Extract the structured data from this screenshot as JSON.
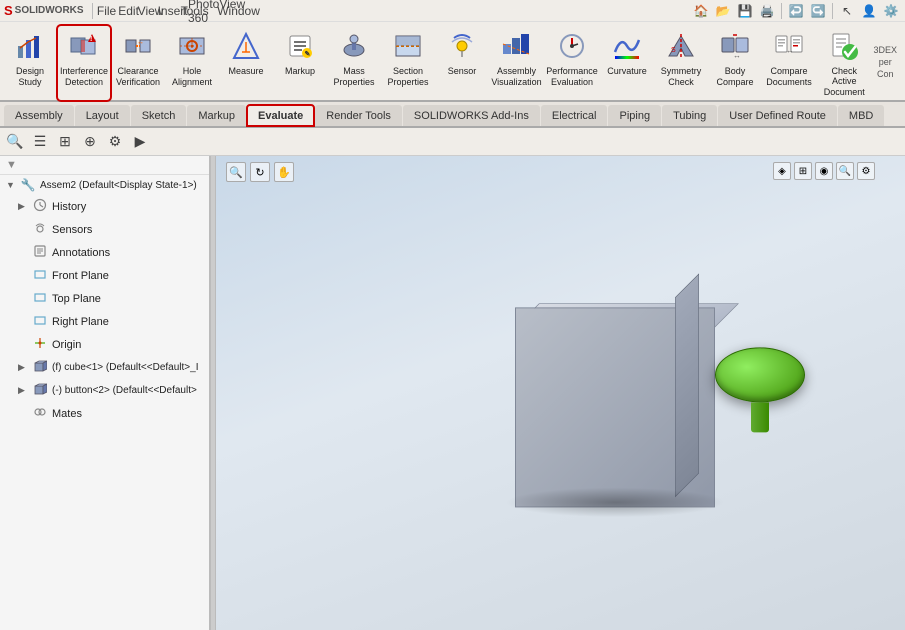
{
  "app": {
    "name": "SOLIDWORKS",
    "logo_s": "S",
    "logo_rest": "SOLIDWORKS"
  },
  "menu": {
    "items": [
      "File",
      "Edit",
      "View",
      "Insert",
      "Tools",
      "PhotoView 360",
      "Window"
    ]
  },
  "toolbar": {
    "groups": [
      {
        "id": "design-study",
        "label": "Design\nStudy",
        "icon": "📊",
        "highlighted": false
      },
      {
        "id": "interference-detection",
        "label": "Interference\nDetection",
        "icon": "🔴",
        "highlighted": true
      },
      {
        "id": "clearance-verification",
        "label": "Clearance\nVerification",
        "icon": "📏",
        "highlighted": false
      },
      {
        "id": "hole-alignment",
        "label": "Hole\nAlignment",
        "icon": "⊙",
        "highlighted": false
      },
      {
        "id": "measure",
        "label": "Measure",
        "icon": "📐",
        "highlighted": false
      },
      {
        "id": "markup",
        "label": "Markup",
        "icon": "✏️",
        "highlighted": false
      },
      {
        "id": "mass-properties",
        "label": "Mass\nProperties",
        "icon": "⚖️",
        "highlighted": false
      },
      {
        "id": "section-properties",
        "label": "Section\nProperties",
        "icon": "📋",
        "highlighted": false
      },
      {
        "id": "sensor",
        "label": "Sensor",
        "icon": "📡",
        "highlighted": false
      },
      {
        "id": "assembly-visualization",
        "label": "Assembly\nVisualization",
        "icon": "🏗️",
        "highlighted": false
      },
      {
        "id": "performance-evaluation",
        "label": "Performance\nEvaluation",
        "icon": "⚡",
        "highlighted": false
      },
      {
        "id": "curvature",
        "label": "Curvature",
        "icon": "〜",
        "highlighted": false
      },
      {
        "id": "symmetry-check",
        "label": "Symmetry\nCheck",
        "icon": "⟺",
        "highlighted": false
      },
      {
        "id": "body-compare",
        "label": "Body\nCompare",
        "icon": "🔍",
        "highlighted": false
      },
      {
        "id": "compare-documents",
        "label": "Compare\nDocuments",
        "icon": "📄",
        "highlighted": false
      },
      {
        "id": "check-active-document",
        "label": "Check Active\nDocument",
        "icon": "✅",
        "highlighted": false
      }
    ]
  },
  "tabs": {
    "items": [
      "Assembly",
      "Layout",
      "Sketch",
      "Markup",
      "Evaluate",
      "Render Tools",
      "SOLIDWORKS Add-Ins",
      "Electrical",
      "Piping",
      "Tubing",
      "User Defined Route",
      "MBD"
    ],
    "active": "Evaluate"
  },
  "tree": {
    "root": "Assem2 (Default<Display State-1>)",
    "items": [
      {
        "label": "History",
        "icon": "🕐",
        "indent": 1,
        "hasArrow": true
      },
      {
        "label": "Sensors",
        "icon": "📡",
        "indent": 1,
        "hasArrow": false
      },
      {
        "label": "Annotations",
        "icon": "📝",
        "indent": 1,
        "hasArrow": false
      },
      {
        "label": "Front Plane",
        "icon": "▭",
        "indent": 1,
        "hasArrow": false
      },
      {
        "label": "Top Plane",
        "icon": "▭",
        "indent": 1,
        "hasArrow": false
      },
      {
        "label": "Right Plane",
        "icon": "▭",
        "indent": 1,
        "hasArrow": false
      },
      {
        "label": "Origin",
        "icon": "⊕",
        "indent": 1,
        "hasArrow": false
      },
      {
        "label": "(f) cube<1> (Default<<Default>_I",
        "icon": "📦",
        "indent": 1,
        "hasArrow": true
      },
      {
        "label": "(-) button<2> (Default<<Default>",
        "icon": "📦",
        "indent": 1,
        "hasArrow": true
      },
      {
        "label": "Mates",
        "icon": "🔗",
        "indent": 1,
        "hasArrow": false
      }
    ]
  },
  "viewport": {
    "background_start": "#c8d8e8",
    "background_end": "#d0d8e0"
  },
  "colors": {
    "highlight_red": "#cc0000",
    "tab_active_bg": "#f0ede8",
    "toolbar_bg": "#f0ede8"
  }
}
